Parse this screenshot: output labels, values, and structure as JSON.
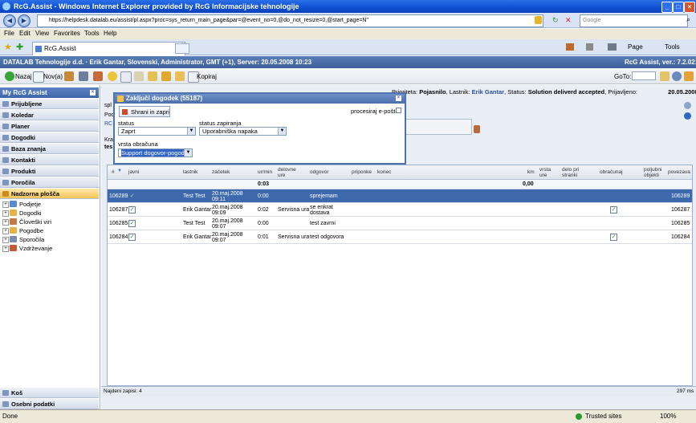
{
  "window": {
    "title": "RcG.Assist - Windows Internet Explorer provided by RcG Informacijske tehnologije"
  },
  "browser": {
    "url": "https://helpdesk.datalab.eu/assist/pl.aspx?proc=sys_return_main_page&par=@event_no=0,@do_not_resize=0,@start_page=N\"",
    "search_placeholder": "Google",
    "menu": [
      "File",
      "Edit",
      "View",
      "Favorites",
      "Tools",
      "Help"
    ],
    "tab_label": "RcG.Assist",
    "cmd_page": "Page",
    "cmd_tools": "Tools",
    "status_done": "Done",
    "status_zone": "Trusted sites",
    "zoom": "100%"
  },
  "app": {
    "header_left": "DATALAB Tehnologije d.d.  ·  Erik Gantar, Slovenski, Administrator, GMT (+1), Server: 20.05.2008 10:23",
    "header_right": "RcG Assist, ver.: 7.2.0213",
    "toolbar": {
      "back": "Nazaj",
      "new": "Nov(a)",
      "copy": "Kopiraj",
      "goto": "GoTo:"
    },
    "sidebar": {
      "header": "My RcG Assist",
      "items": [
        "Prijubljene",
        "Koledar",
        "Planer",
        "Dogodki",
        "Baza znanja",
        "Kontakti",
        "Produkti",
        "Poročila",
        "Nadzorna plošča"
      ],
      "tree": [
        "Podjetje",
        "Dogodki",
        "Človeški viri",
        "Pogodbe",
        "Sporočila",
        "Vzdrževanje"
      ],
      "bottom": [
        "Koš",
        "Osebni podatki"
      ]
    },
    "info": {
      "prefix": "Prioriteta:",
      "priority": "Pojasnilo",
      "owner_label": ", Lastnik:",
      "owner": "Erik Gantar",
      "status_label": ", Status:",
      "status": "Solution deliverd accepted",
      "registered_label": ", Prijavljeno:",
      "registered": "20.05.2008 09:06"
    },
    "behind_labels": {
      "spl": "spl",
      "pod": "Pod",
      "rc": "RC",
      "kra": "Kra",
      "tes": "tes"
    },
    "modal": {
      "title": "Zaključi dogodek (55187)",
      "save_button": "Shrani in zapri",
      "process_email": "procesiraj e-pošto",
      "status_label": "status",
      "status_value": "Zaprt",
      "closing_status_label": "status zapiranja",
      "closing_status_value": "Uporabniška napaka",
      "billing_type_label": "vrsta obračuna",
      "billing_type_value": "Support dogovor-pogodba"
    },
    "grid": {
      "headers": {
        "num": "#",
        "public": "javni",
        "owner": "lastnik",
        "start": "začetek",
        "hours": "ur/min",
        "work_hours": "delovne ure",
        "answer": "odgovor",
        "attachments": "priponke",
        "end": "konec",
        "km": "km",
        "hours_type": "vrsta ure",
        "at_client": "delo pri stranki",
        "billing": "obračunaj",
        "optional_objects": "poljubni objekti",
        "link": "povezava"
      },
      "sum_hours": "0:03",
      "sum_km": "0,00",
      "rows": [
        {
          "id": "106289",
          "public": true,
          "owner": "Test Test",
          "start1": "20.maj.2008",
          "start2": "09:11",
          "hours": "0:00",
          "work": "",
          "answer1": "sprejemam",
          "answer2": "",
          "billing": false,
          "link": "106289",
          "selected": true
        },
        {
          "id": "106287",
          "public": true,
          "owner": "Erik Gantar",
          "start1": "20.maj.2008",
          "start2": "09:09",
          "hours": "0:02",
          "work": "Servisna ura",
          "answer1": "se enkrat",
          "answer2": "dostava",
          "billing": true,
          "link": "106287",
          "selected": false
        },
        {
          "id": "106285",
          "public": true,
          "owner": "Test Test",
          "start1": "20.maj.2008",
          "start2": "09:07",
          "hours": "0:00",
          "work": "",
          "answer1": "test zavrni",
          "answer2": "",
          "billing": false,
          "link": "106285",
          "selected": false
        },
        {
          "id": "106284",
          "public": true,
          "owner": "Erik Gantar",
          "start1": "20.maj.2008",
          "start2": "09:07",
          "hours": "0:01",
          "work": "Servisna ura",
          "answer1": "test odgovora",
          "answer2": "",
          "billing": true,
          "link": "106284",
          "selected": false
        }
      ],
      "found_records": "Najdeni zapisi: 4",
      "timing": "297 ms"
    }
  }
}
